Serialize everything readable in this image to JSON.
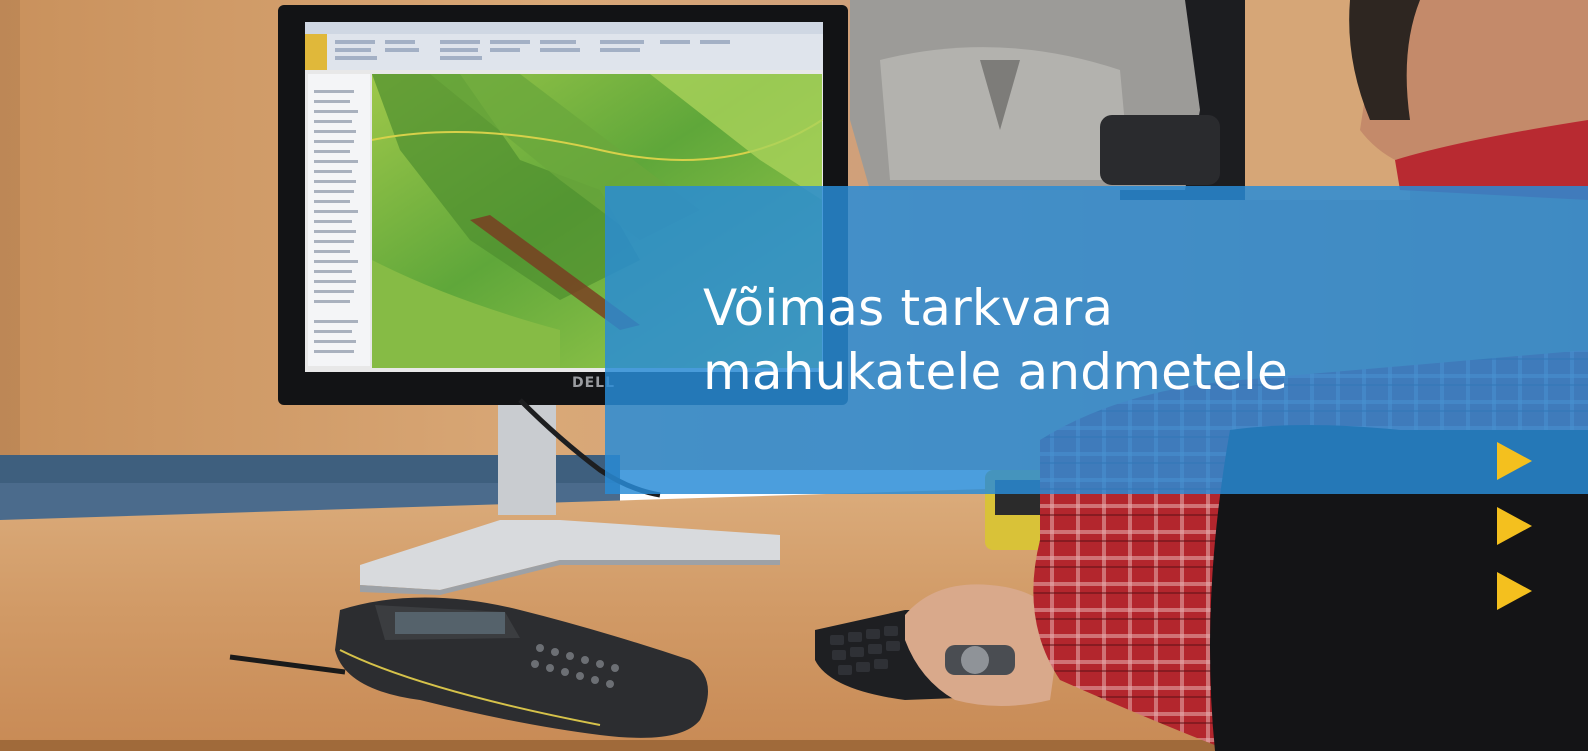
{
  "banner": {
    "headline_line1": "Võimas tarkvara",
    "headline_line2": "mahukatele andmetele",
    "color": "#2f8fd6"
  },
  "decor": {
    "arrow_color": "#f4c01e",
    "arrow_count": 3,
    "arrow_icon": "play-triangle-icon"
  },
  "photo": {
    "monitor_brand": "DELL"
  }
}
